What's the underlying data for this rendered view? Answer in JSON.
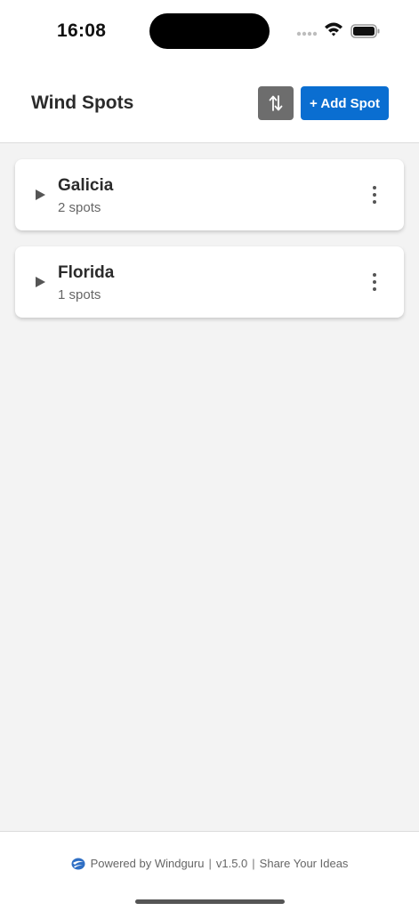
{
  "status_bar": {
    "time": "16:08"
  },
  "header": {
    "title": "Wind Spots",
    "add_button": "+ Add Spot"
  },
  "groups": [
    {
      "name": "Galicia",
      "count": "2 spots"
    },
    {
      "name": "Florida",
      "count": "1 spots"
    }
  ],
  "footer": {
    "powered": "Powered by Windguru",
    "version": "v1.5.0",
    "share": "Share Your Ideas",
    "separator": "|"
  },
  "colors": {
    "accent": "#0a6ed1",
    "sort_button": "#6d6d6d"
  },
  "icons": {
    "sort": "arrows-up-down-icon",
    "expand": "triangle-right-icon",
    "menu": "more-vertical-icon",
    "logo": "windguru-logo-icon"
  }
}
